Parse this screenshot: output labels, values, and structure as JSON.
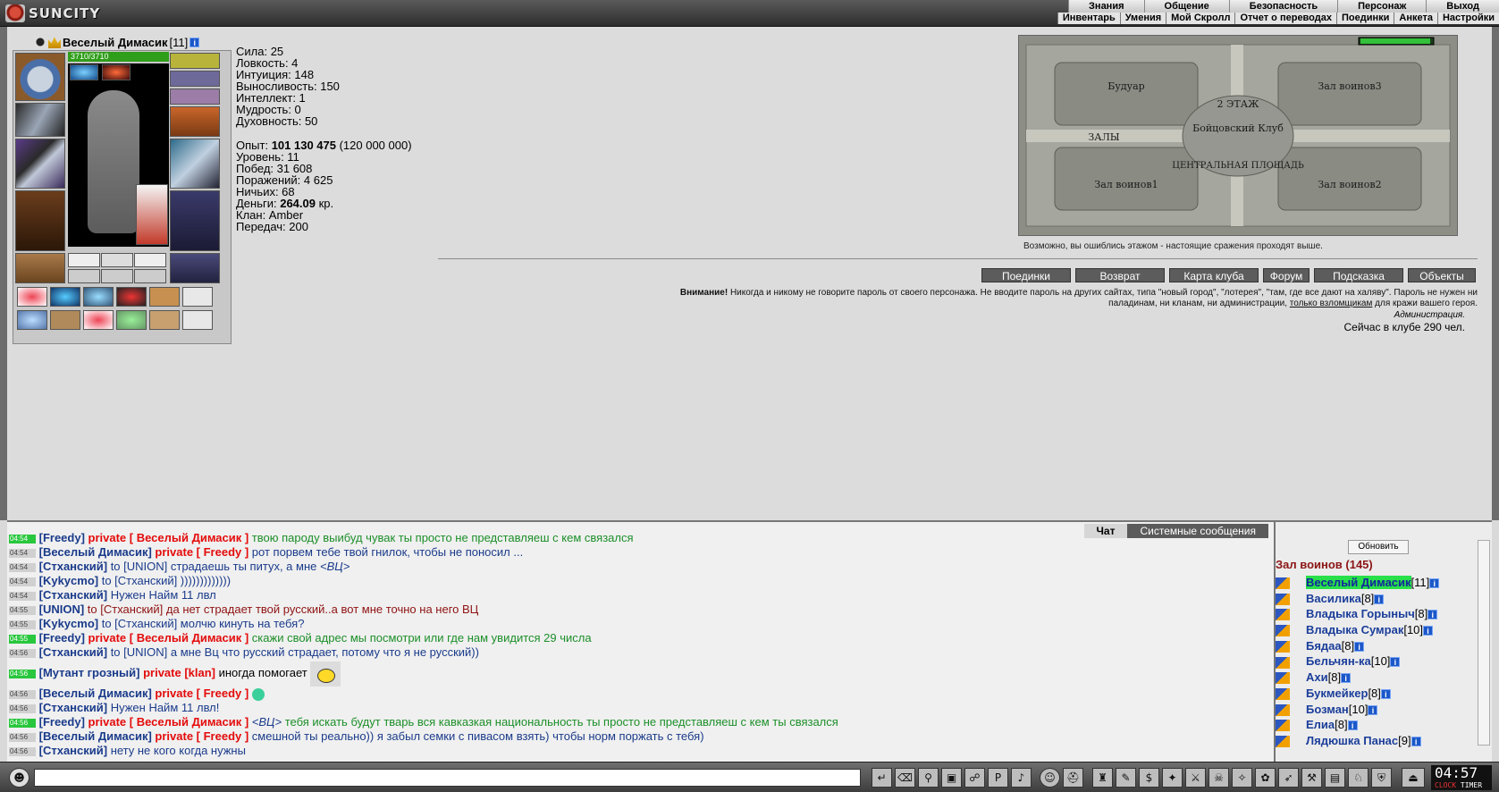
{
  "app": {
    "logo_text": "SUNCITY"
  },
  "top_menu": [
    "Знания",
    "Общение",
    "Безопасность",
    "Персонаж",
    "Выход"
  ],
  "sub_menu": [
    "Инвентарь",
    "Умения",
    "Мой Скролл",
    "Отчет о переводах",
    "Поединки",
    "Анкета",
    "Настройки"
  ],
  "character": {
    "name": "Веселый Димасик",
    "level": "[11]",
    "hp": "3710/3710"
  },
  "stats": [
    "Сила: 25",
    "Ловкость: 4",
    "Интуиция: 148",
    "Выносливость: 150",
    "Интеллект: 1",
    "Мудрость: 0",
    "Духовность: 50"
  ],
  "progress": {
    "exp_label": "Опыт: ",
    "exp_value": "101 130 475",
    "exp_next": " (120 000 000)",
    "level": "Уровень: 11",
    "wins": "Побед: 31 608",
    "losses": "Поражений: 4 625",
    "draws": "Ничьих: 68",
    "money_label": "Деньги: ",
    "money_value": "264.09",
    "money_unit": " кр.",
    "clan": "Клан: Amber",
    "transfers": "Передач: 200"
  },
  "map": {
    "note": "Возможно, вы ошиблись этажом - настоящие сражения проходят выше.",
    "labels": {
      "boudoir": "Будуар",
      "hall3": "Зал воинов3",
      "floor": "2 ЭТАЖ",
      "halls": "ЗАЛЫ",
      "club": "Бойцовский Клуб",
      "square": "ЦЕНТРАЛЬНАЯ ПЛОЩАДЬ",
      "hall1": "Зал воинов1",
      "hall2": "Зал воинов2"
    }
  },
  "buttons": [
    "Поединки",
    "Возврат",
    "Карта клуба",
    "Форум",
    "Подсказка",
    "Объекты"
  ],
  "warning": {
    "title": "Внимание!",
    "text1": " Никогда и никому не говорите пароль от своего персонажа. Не вводите пароль на других сайтах, типа \"новый город\", \"лотерея\", \"там, где все дают на халяву\". Пароль не нужен ни",
    "text2": "паладинам, ни кланам, ни администрации, ",
    "link": "только взломщикам",
    "text3": " для кражи вашего героя.",
    "admin": "Администрация.",
    "online": "Сейчас в клубе 290 чел."
  },
  "chat": {
    "tabs": [
      "Чат",
      "Системные сообщения"
    ],
    "lines": [
      {
        "t": "04:54",
        "hl": true,
        "parts": [
          [
            "n",
            "[Freedy]"
          ],
          [
            "p",
            " private [ Веселый Димасик ] "
          ],
          [
            "g",
            "твою пароду выибуд чувак ты просто не представляеш с кем связался"
          ]
        ]
      },
      {
        "t": "04:54",
        "hl": false,
        "parts": [
          [
            "n",
            "[Веселый Димасик]"
          ],
          [
            "p",
            " private [ Freedy ] "
          ],
          [
            "b",
            "рот порвем тебе твой гнилок, чтобы не поносил ..."
          ]
        ]
      },
      {
        "t": "04:54",
        "hl": false,
        "parts": [
          [
            "n",
            "[Стханский]"
          ],
          [
            "b",
            " to [UNION] страдаешь ты питух, а мне "
          ],
          [
            "v",
            "<ВЦ>"
          ]
        ]
      },
      {
        "t": "04:54",
        "hl": false,
        "parts": [
          [
            "n",
            "[Kykycmo]"
          ],
          [
            "b",
            " to [Стханский] )))))))))))))"
          ]
        ]
      },
      {
        "t": "04:54",
        "hl": false,
        "parts": [
          [
            "n",
            "[Стханский]"
          ],
          [
            "b",
            " Нужен Найм 11 лвл"
          ]
        ]
      },
      {
        "t": "04:55",
        "hl": false,
        "parts": [
          [
            "n",
            "[UNION]"
          ],
          [
            "r",
            " to [Стханский] да нет страдает твой русский..а вот мне точно на него ВЦ"
          ]
        ]
      },
      {
        "t": "04:55",
        "hl": false,
        "parts": [
          [
            "n",
            "[Kykycmo]"
          ],
          [
            "b",
            " to [Стханский] молчю кинуть на тебя?"
          ]
        ]
      },
      {
        "t": "04:55",
        "hl": true,
        "parts": [
          [
            "n",
            "[Freedy]"
          ],
          [
            "p",
            " private [ Веселый Димасик ] "
          ],
          [
            "g",
            "скажи свой адрес мы посмотри или где нам увидится 29 числа"
          ]
        ]
      },
      {
        "t": "04:56",
        "hl": false,
        "parts": [
          [
            "n",
            "[Стханский]"
          ],
          [
            "b",
            " to [UNION] а мне Вц что русский страдает, потому что я не русский))"
          ]
        ]
      }
    ],
    "mutant_line": {
      "t": "04:56",
      "hl": true,
      "nick": "[Мутант грозный]",
      "priv": " private [klan] ",
      "msg": "иногда помогает"
    },
    "lines2": [
      {
        "t": "04:56",
        "hl": false,
        "parts": [
          [
            "n",
            "[Веселый Димасик]"
          ],
          [
            "p",
            " private [ Freedy ] "
          ]
        ]
      },
      {
        "t": "04:56",
        "hl": false,
        "parts": [
          [
            "n",
            "[Стханский]"
          ],
          [
            "b",
            " Нужен Найм 11 лвл!"
          ]
        ]
      },
      {
        "t": "04:56",
        "hl": true,
        "parts": [
          [
            "n",
            "[Freedy]"
          ],
          [
            "p",
            " private [ Веселый Димасик ] "
          ],
          [
            "v",
            "<ВЦ>"
          ],
          [
            "g",
            " тебя искать будут тварь вся кавказкая национальность ты просто не представляеш с кем ты связался"
          ]
        ]
      },
      {
        "t": "04:56",
        "hl": false,
        "parts": [
          [
            "n",
            "[Веселый Димасик]"
          ],
          [
            "p",
            " private [ Freedy ] "
          ],
          [
            "b",
            "смешной ты реально)) я забыл семки с пивасом взять) чтобы норм поржать с тебя)"
          ]
        ]
      },
      {
        "t": "04:56",
        "hl": false,
        "parts": [
          [
            "n",
            "[Стханский]"
          ],
          [
            "b",
            " нету не кого когда нужны"
          ]
        ]
      }
    ]
  },
  "panel": {
    "refresh": "Обновить",
    "room": "Зал воинов (145)",
    "users": [
      {
        "n": "Веселый Димасик",
        "l": "[11]",
        "me": true
      },
      {
        "n": "Василика",
        "l": "[8]"
      },
      {
        "n": "Владыка Горыныч",
        "l": "[8]"
      },
      {
        "n": "Владыка Сумрак",
        "l": "[10]"
      },
      {
        "n": "Бядаа",
        "l": "[8]"
      },
      {
        "n": "Бельчян-ка",
        "l": "[10]"
      },
      {
        "n": "Ахи",
        "l": "[8]"
      },
      {
        "n": "Букмейкер",
        "l": "[8]"
      },
      {
        "n": "Бозман",
        "l": "[10]"
      },
      {
        "n": "Елиа",
        "l": "[8]"
      },
      {
        "n": "Лядюшка Панас",
        "l": "[9]"
      }
    ]
  },
  "clock": {
    "time": "04:57",
    "label1": "CLOCK",
    "label2": "TIMER"
  }
}
